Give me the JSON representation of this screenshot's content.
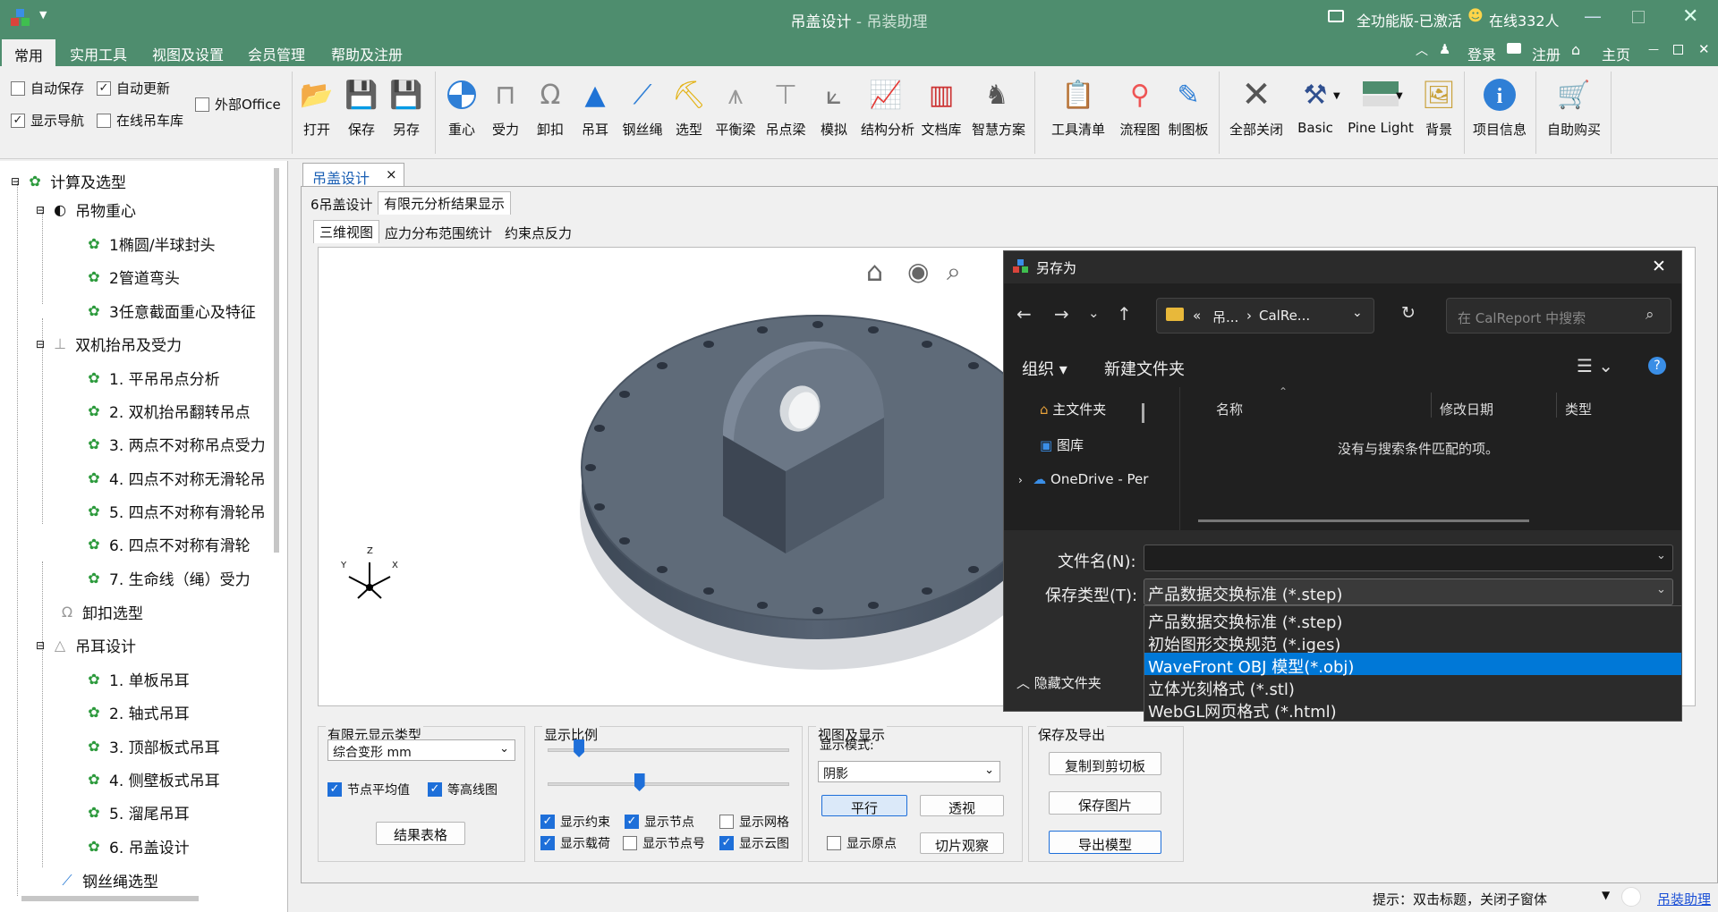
{
  "window": {
    "title": "吊盖设计",
    "subtitle": " - 吊装助理",
    "license": "全功能版-已激活",
    "online": "在线332人"
  },
  "ribbon_tabs": [
    "常用",
    "实用工具",
    "视图及设置",
    "会员管理",
    "帮助及注册"
  ],
  "account_links": {
    "login": "登录",
    "register": "注册",
    "home": "主页"
  },
  "options": {
    "auto_save": "自动保存",
    "auto_update": "自动更新",
    "show_nav": "显示导航",
    "online_library": "在线吊车库",
    "external_office": "外部Office"
  },
  "toolbar": {
    "open": "打开",
    "save": "保存",
    "save_as": "另存",
    "center": "重心",
    "force": "受力",
    "shackle": "卸扣",
    "lug": "吊耳",
    "wire": "钢丝绳",
    "select": "选型",
    "balance": "平衡梁",
    "spreader": "吊点梁",
    "simulate": "模拟",
    "structure": "结构分析",
    "doclib": "文档库",
    "smart": "智慧方案",
    "tool_list": "工具清单",
    "flowchart": "流程图",
    "drawing": "制图板",
    "close_all": "全部关闭",
    "basic": "Basic",
    "pine_light": "Pine Light",
    "background": "背景",
    "project_info": "项目信息",
    "buy": "自助购买"
  },
  "tree": {
    "root": "计算及选型",
    "g1": "吊物重心",
    "g1_items": [
      "1椭圆/半球封头",
      "2管道弯头",
      "3任意截面重心及特征"
    ],
    "g2": "双机抬吊及受力",
    "g2_items": [
      "1. 平吊吊点分析",
      "2. 双机抬吊翻转吊点",
      "3. 两点不对称吊点受力",
      "4. 四点不对称无滑轮吊",
      "5. 四点不对称有滑轮吊",
      "6. 四点不对称有滑轮",
      "7. 生命线（绳）受力"
    ],
    "g3": "卸扣选型",
    "g4": "吊耳设计",
    "g4_items": [
      "1. 单板吊耳",
      "2. 轴式吊耳",
      "3. 顶部板式吊耳",
      "4. 侧壁板式吊耳",
      "5. 溜尾吊耳",
      "6. 吊盖设计"
    ],
    "g5": "钢丝绳选型"
  },
  "doc_tab": {
    "label": "吊盖设计",
    "close": "×"
  },
  "sub_tabs": [
    "6吊盖设计",
    "有限元分析结果显示"
  ],
  "view_tabs": [
    "三维视图",
    "应力分布范围统计",
    "约束点反力"
  ],
  "axes": {
    "y": "Y",
    "z": "Z",
    "x": "X"
  },
  "fem_group": {
    "title": "有限元显示类型",
    "type_value": "综合变形 mm",
    "node_avg": "节点平均值",
    "contour": "等高线图",
    "result_table": "结果表格"
  },
  "scale_group": {
    "title": "显示比例",
    "slider1": 0.13,
    "slider2": 0.38,
    "show_constraint": "显示约束",
    "show_node": "显示节点",
    "show_mesh": "显示网格",
    "show_load": "显示载荷",
    "show_node_no": "显示节点号",
    "show_cloud": "显示云图"
  },
  "view_group": {
    "title": "视图及显示",
    "mode_label": "显示模式:",
    "mode_value": "阴影",
    "parallel": "平行",
    "perspective": "透视",
    "show_origin": "显示原点",
    "slice": "切片观察"
  },
  "export_group": {
    "title": "保存及导出",
    "copy": "复制到剪切板",
    "save_image": "保存图片",
    "export_model": "导出模型"
  },
  "dialog": {
    "title": "另存为",
    "breadcrumb": [
      "«",
      "吊...",
      "›",
      "CalRe..."
    ],
    "search_placeholder": "在 CalReport 中搜索",
    "organize": "组织 ▾",
    "new_folder": "新建文件夹",
    "nav": [
      "主文件夹",
      "图库",
      "OneDrive - Per"
    ],
    "columns": [
      "名称",
      "修改日期",
      "类型"
    ],
    "empty": "没有与搜索条件匹配的项。",
    "filename_label": "文件名(N):",
    "filename_value": "",
    "filetype_label": "保存类型(T):",
    "filetype_value": "产品数据交换标准 (*.step)",
    "options": [
      "产品数据交换标准 (*.step)",
      "初始图形交换规范 (*.iges)",
      "WaveFront OBJ 模型(*.obj)",
      "立体光刻格式 (*.stl)",
      "WebGL网页格式 (*.html)"
    ],
    "selected_index": 2,
    "hide_folders": "隐藏文件夹"
  },
  "status": {
    "hint": "提示：双击标题，关闭子窗体",
    "link": "吊装助理"
  },
  "colors": {
    "brand": "#4e8d6e",
    "accent": "#0078d7",
    "dialog_bg": "#202020"
  }
}
